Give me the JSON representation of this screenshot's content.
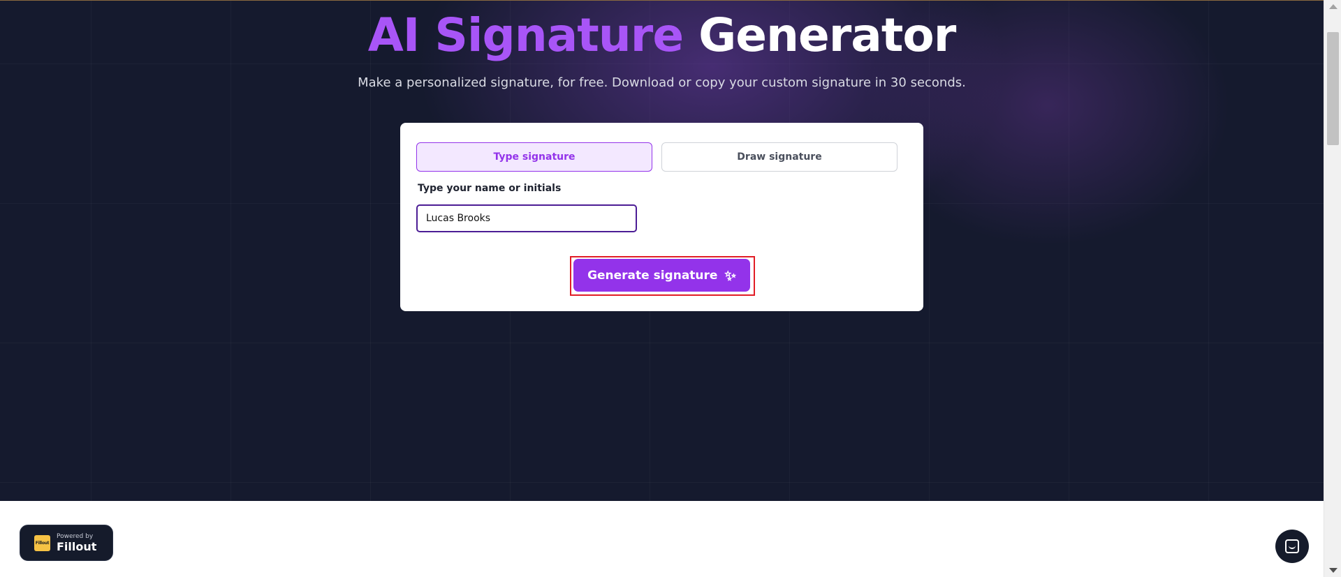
{
  "hero": {
    "title_accent": "AI Signature",
    "title_plain": "Generator",
    "subtitle": "Make a personalized signature, for free. Download or copy your custom signature in 30 seconds."
  },
  "card": {
    "tabs": [
      {
        "label": "Type signature",
        "active": true
      },
      {
        "label": "Draw signature",
        "active": false
      }
    ],
    "name_label": "Type your name or initials",
    "name_value": "Lucas Brooks",
    "generate_label": "Generate signature",
    "generate_icon": "sparkles-icon"
  },
  "badge": {
    "powered_by": "Powered by",
    "brand": "Fillout",
    "logo_text": "Fillout"
  },
  "chat": {
    "icon": "chat-icon"
  },
  "colors": {
    "accent": "#a855f7",
    "button": "#9333ea",
    "hero_bg": "#151a2e",
    "highlight": "#e11d26"
  }
}
